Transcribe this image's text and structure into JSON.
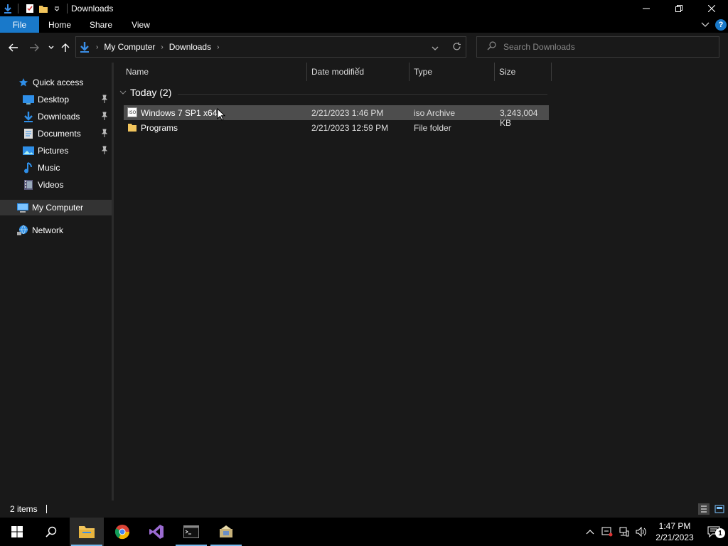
{
  "window": {
    "title": "Downloads"
  },
  "ribbon": {
    "tabs": [
      "File",
      "Home",
      "Share",
      "View"
    ]
  },
  "address": {
    "crumbs": [
      "My Computer",
      "Downloads"
    ],
    "search_placeholder": "Search Downloads"
  },
  "sidebar": {
    "items": [
      {
        "label": "Quick access",
        "icon": "star-icon"
      },
      {
        "label": "Desktop",
        "icon": "desktop-icon",
        "pinned": true
      },
      {
        "label": "Downloads",
        "icon": "download-arrow-icon",
        "pinned": true
      },
      {
        "label": "Documents",
        "icon": "documents-icon",
        "pinned": true
      },
      {
        "label": "Pictures",
        "icon": "pictures-icon",
        "pinned": true
      },
      {
        "label": "Music",
        "icon": "music-icon"
      },
      {
        "label": "Videos",
        "icon": "videos-icon"
      },
      {
        "label": "My Computer",
        "icon": "computer-icon",
        "selected": true
      },
      {
        "label": "Network",
        "icon": "network-icon"
      }
    ]
  },
  "list": {
    "columns": [
      "Name",
      "Date modified",
      "Type",
      "Size"
    ],
    "group": "Today (2)",
    "rows": [
      {
        "name": "Windows 7 SP1 x64",
        "date": "2/21/2023 1:46 PM",
        "type": "iso Archive",
        "size": "3,243,004 KB",
        "icon": "iso-file-icon",
        "selected": true
      },
      {
        "name": "Programs",
        "date": "2/21/2023 12:59 PM",
        "type": "File folder",
        "size": "",
        "icon": "folder-icon",
        "selected": false
      }
    ]
  },
  "status": {
    "items": "2 items"
  },
  "taskbar": {
    "clock_time": "1:47 PM",
    "clock_date": "2/21/2023",
    "notification_count": "1"
  },
  "colors": {
    "accent": "#1979ca",
    "folder": "#f2c55c",
    "selection": "#4d4d4d"
  }
}
